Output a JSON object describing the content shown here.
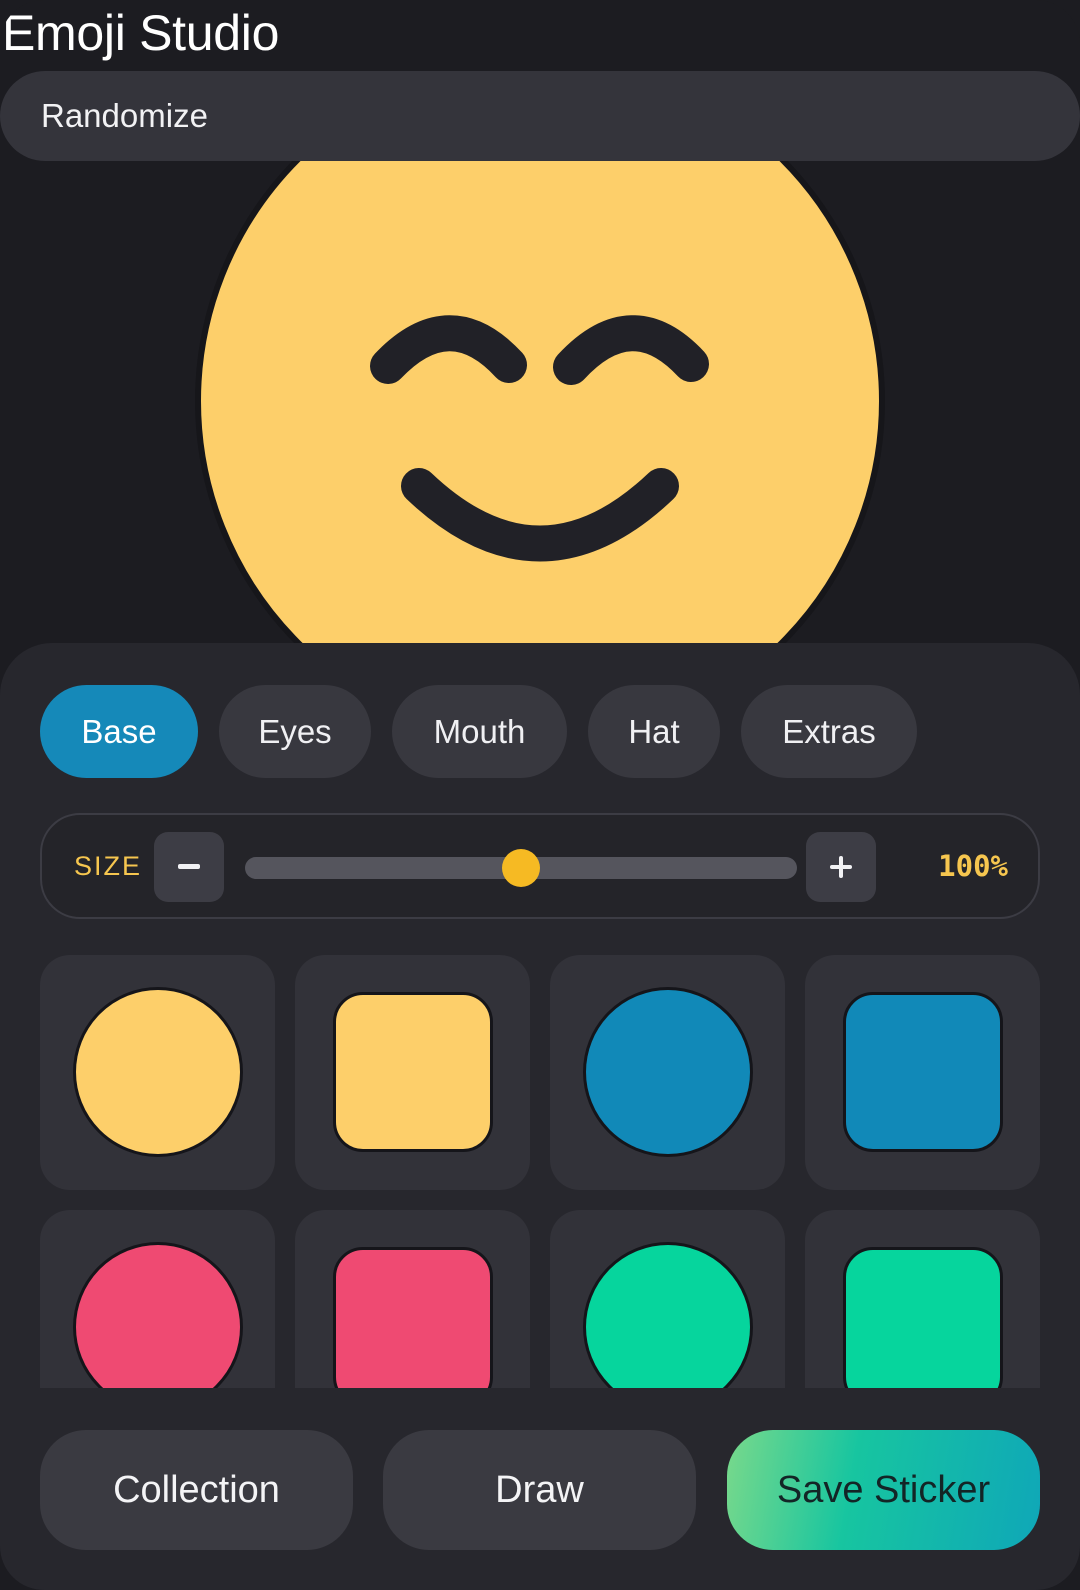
{
  "app": {
    "title": "Emoji Studio"
  },
  "toolbar": {
    "randomize_label": "Randomize"
  },
  "preview": {
    "face_color": "#fdcf6a",
    "feature_color": "#212127",
    "eyes": "smiling-closed-eyes",
    "mouth": "smile"
  },
  "tabs": [
    {
      "label": "Base",
      "active": true
    },
    {
      "label": "Eyes",
      "active": false
    },
    {
      "label": "Mouth",
      "active": false
    },
    {
      "label": "Hat",
      "active": false
    },
    {
      "label": "Extras",
      "active": false
    }
  ],
  "size": {
    "label": "SIZE",
    "minus_icon": "minus-icon",
    "plus_icon": "plus-icon",
    "value_text": "100%",
    "slider_level": 0.5
  },
  "bases": [
    {
      "shape": "circle",
      "color": "#fdcf6a"
    },
    {
      "shape": "square",
      "color": "#fdcf6a"
    },
    {
      "shape": "circle",
      "color": "#1189b8"
    },
    {
      "shape": "square",
      "color": "#1189b8"
    },
    {
      "shape": "circle",
      "color": "#ef4a72"
    },
    {
      "shape": "square",
      "color": "#ef4a72"
    },
    {
      "shape": "circle",
      "color": "#06d59d"
    },
    {
      "shape": "square",
      "color": "#06d59d"
    }
  ],
  "actions": {
    "collection_label": "Collection",
    "draw_label": "Draw",
    "save_label": "Save Sticker"
  },
  "colors": {
    "accent": "#1589b9",
    "highlight": "#f6c64f",
    "background": "#1c1c21"
  }
}
